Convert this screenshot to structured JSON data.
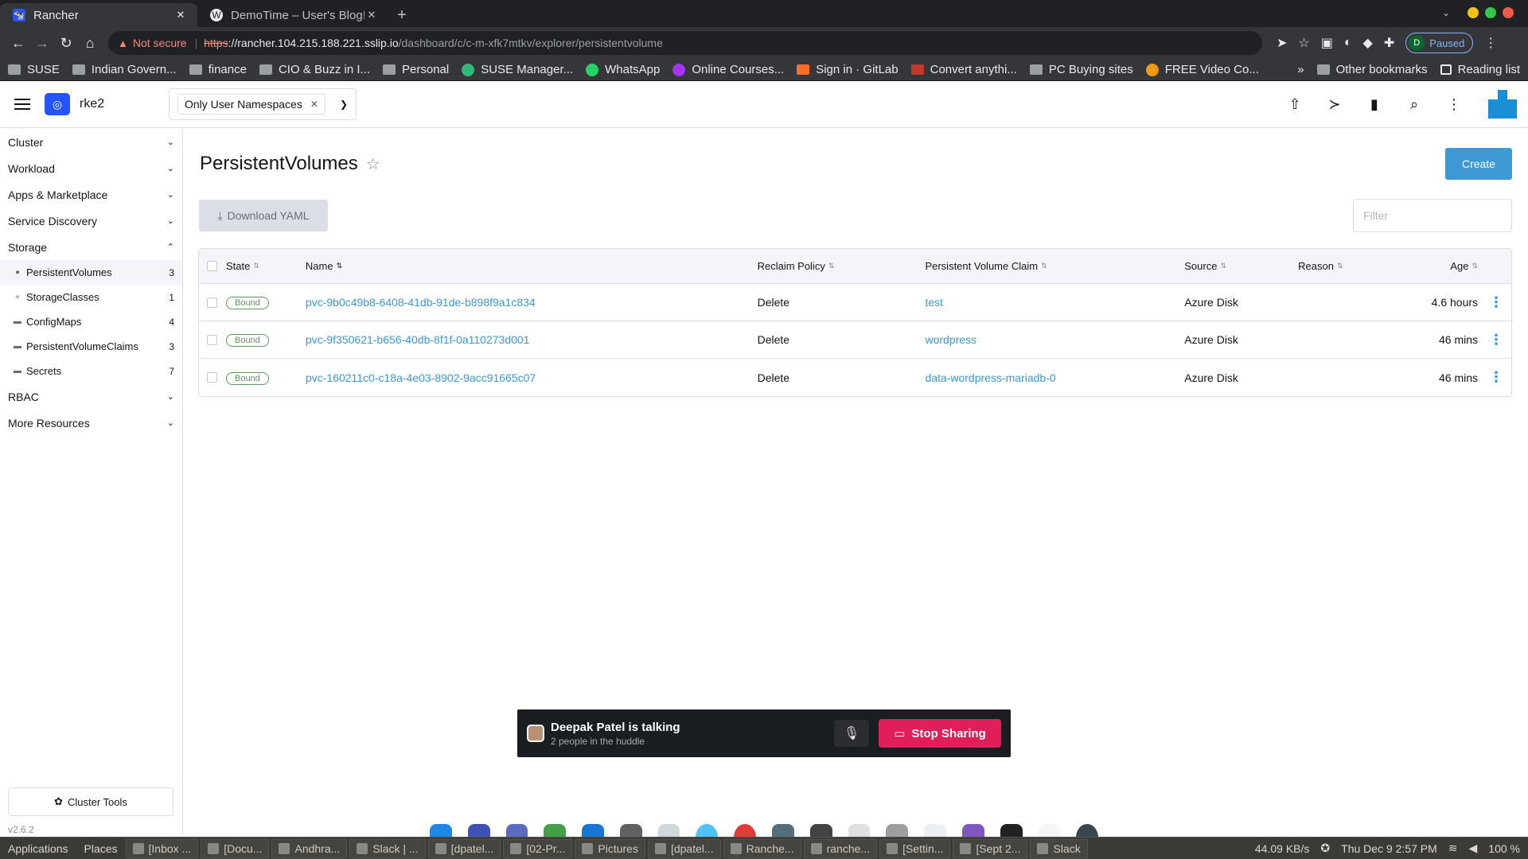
{
  "browser": {
    "tabs": [
      {
        "title": "Rancher",
        "active": true
      },
      {
        "title": "DemoTime – User's Blog!",
        "active": false
      }
    ],
    "url": {
      "warning": "Not secure",
      "protocol": "https",
      "host": "://rancher.104.215.188.221.sslip.io",
      "path": "/dashboard/c/c-m-xfk7mtkv/explorer/persistentvolume"
    },
    "profile": {
      "initial": "D",
      "status": "Paused"
    },
    "bookmarks": [
      "SUSE",
      "Indian Govern...",
      "finance",
      "CIO & Buzz in I...",
      "Personal",
      "SUSE Manager...",
      "WhatsApp",
      "Online Courses...",
      "Sign in · GitLab",
      "Convert anythi...",
      "PC Buying sites",
      "FREE Video Co..."
    ],
    "bookmarks_more": "»",
    "other_bookmarks": "Other bookmarks",
    "reading_list": "Reading list"
  },
  "header": {
    "cluster_name": "rke2",
    "namespace_filter": "Only User Namespaces"
  },
  "sidebar": {
    "groups": {
      "cluster": "Cluster",
      "workload": "Workload",
      "apps": "Apps & Marketplace",
      "service_discovery": "Service Discovery",
      "storage": "Storage",
      "rbac": "RBAC",
      "more": "More Resources"
    },
    "storage_items": [
      {
        "label": "PersistentVolumes",
        "count": "3"
      },
      {
        "label": "StorageClasses",
        "count": "1"
      },
      {
        "label": "ConfigMaps",
        "count": "4"
      },
      {
        "label": "PersistentVolumeClaims",
        "count": "3"
      },
      {
        "label": "Secrets",
        "count": "7"
      }
    ],
    "cluster_tools": "Cluster Tools",
    "version": "v2.6.2"
  },
  "main": {
    "title": "PersistentVolumes",
    "create_label": "Create",
    "download_label": "Download YAML",
    "filter_placeholder": "Filter",
    "columns": [
      "State",
      "Name",
      "Reclaim Policy",
      "Persistent Volume Claim",
      "Source",
      "Reason",
      "Age"
    ],
    "rows": [
      {
        "state": "Bound",
        "name": "pvc-9b0c49b8-6408-41db-91de-b898f9a1c834",
        "reclaim": "Delete",
        "pvc": "test",
        "source": "Azure Disk",
        "reason": "",
        "age": "4.6 hours"
      },
      {
        "state": "Bound",
        "name": "pvc-9f350621-b656-40db-8f1f-0a110273d001",
        "reclaim": "Delete",
        "pvc": "wordpress",
        "source": "Azure Disk",
        "reason": "",
        "age": "46 mins"
      },
      {
        "state": "Bound",
        "name": "pvc-160211c0-c18a-4e03-8902-9acc91665c07",
        "reclaim": "Delete",
        "pvc": "data-wordpress-mariadb-0",
        "source": "Azure Disk",
        "reason": "",
        "age": "46 mins"
      }
    ]
  },
  "huddle": {
    "talking": "Deepak Patel is talking",
    "people": "2 people in the huddle",
    "stop_label": "Stop Sharing"
  },
  "taskbar": {
    "applications": "Applications",
    "places": "Places",
    "tasks": [
      "[Inbox ...",
      "[Docu...",
      "Andhra...",
      "Slack | ...",
      "[dpatel...",
      "[02-Pr...",
      "Pictures",
      "[dpatel...",
      "Ranche...",
      "ranche...",
      "[Settin...",
      "[Sept 2...",
      "Slack"
    ],
    "network": "44.09 KB/s",
    "datetime": "Thu Dec 9   2:57 PM",
    "battery": "100 %"
  },
  "colors": {
    "accent": "#3d98d3",
    "bound_badge": "#5d995d",
    "stop_sharing": "#e01e5a",
    "rancher_logo": "#2453ff"
  }
}
